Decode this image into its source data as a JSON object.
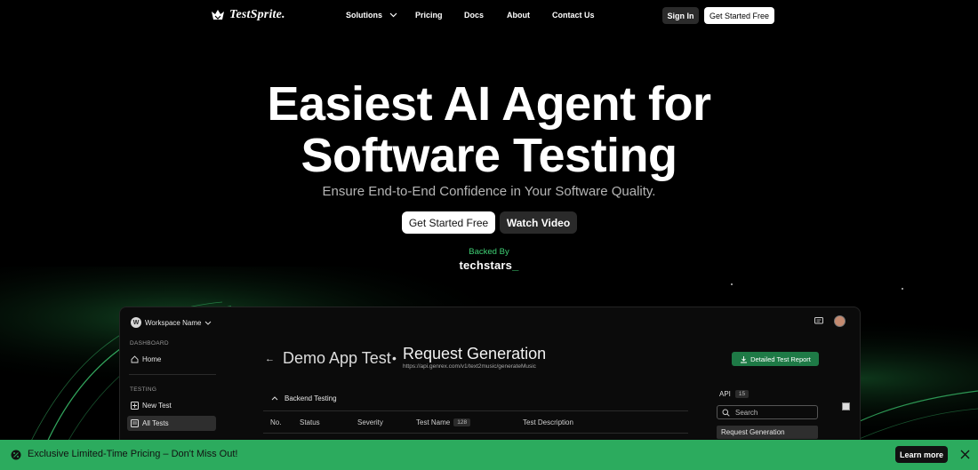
{
  "nav": {
    "brand": "TestSprite.",
    "links": [
      "Solutions",
      "Pricing",
      "Docs",
      "About",
      "Contact Us"
    ],
    "sign_in": "Sign In",
    "get_started": "Get Started Free"
  },
  "hero": {
    "title_line1": "Easiest AI Agent for",
    "title_line2": "Software Testing",
    "subtitle": "Ensure End-to-End Confidence in Your Software Quality.",
    "cta_primary": "Get Started Free",
    "cta_secondary": "Watch Video",
    "backed_by": "Backed By",
    "backer": "techstars",
    "backer_suffix": "_"
  },
  "app": {
    "workspace": {
      "avatar_letter": "W",
      "name": "Workspace Name"
    },
    "sidebar": {
      "dashboard_heading": "DASHBOARD",
      "home": "Home",
      "testing_heading": "TESTING",
      "new_test": "New Test",
      "all_tests": "All Tests"
    },
    "breadcrumb": {
      "project": "Demo App Test",
      "page": "Request Generation",
      "url": "https://api.genrex.com/v1/text2music/generateMusic"
    },
    "report_button": "Detailed Test Report",
    "section": "Backend Testing",
    "table": {
      "headers": [
        "No.",
        "Status",
        "Severity",
        "Test Name",
        "Test Description"
      ],
      "test_name_count": "128"
    },
    "api_panel": {
      "label": "API",
      "count": "15",
      "search_placeholder": "Search",
      "selected_item": "Request Generation"
    }
  },
  "banner": {
    "text": "Exclusive Limited-Time Pricing – Don't Miss Out!",
    "learn_more": "Learn more"
  },
  "colors": {
    "accent_green": "#2cab5e",
    "background": "#000000",
    "report_button": "#1e7a46"
  }
}
